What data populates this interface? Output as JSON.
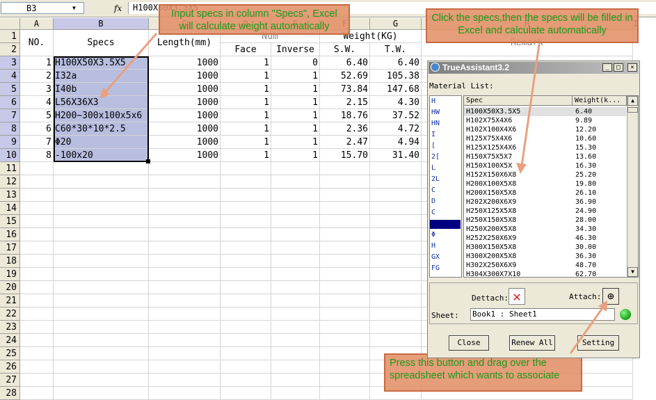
{
  "formula": {
    "name_box": "B3",
    "fx": "fx",
    "value": "H100X50X3.5X5"
  },
  "columns": [
    "A",
    "B",
    "C",
    "D",
    "E",
    "F",
    "G",
    "H",
    "I"
  ],
  "rows": [
    "1",
    "2",
    "3",
    "4",
    "5",
    "6",
    "7",
    "8",
    "9",
    "10",
    "11",
    "12",
    "13",
    "14",
    "15",
    "16",
    "17",
    "18",
    "19",
    "20",
    "21",
    "22",
    "23",
    "24",
    "25",
    "26",
    "27",
    "28"
  ],
  "headers": {
    "no": "NO.",
    "specs": "Specs",
    "length": "Length(mm)",
    "num": "Num",
    "face": "Face",
    "inverse": "Inverse",
    "weight": "Weight(KG)",
    "sw": "S.W.",
    "tw": "T.W.",
    "remark": "Remark"
  },
  "table": [
    {
      "no": "1",
      "spec": "H100X50X3.5X5",
      "length": "1000",
      "face": "1",
      "inverse": "0",
      "sw": "6.40",
      "tw": "6.40"
    },
    {
      "no": "2",
      "spec": "I32a",
      "length": "1000",
      "face": "1",
      "inverse": "1",
      "sw": "52.69",
      "tw": "105.38"
    },
    {
      "no": "3",
      "spec": "I40b",
      "length": "1000",
      "face": "1",
      "inverse": "1",
      "sw": "73.84",
      "tw": "147.68"
    },
    {
      "no": "4",
      "spec": "L56X36X3",
      "length": "1000",
      "face": "1",
      "inverse": "1",
      "sw": "2.15",
      "tw": "4.30"
    },
    {
      "no": "5",
      "spec": "H200~300x100x5x6",
      "length": "1000",
      "face": "1",
      "inverse": "1",
      "sw": "18.76",
      "tw": "37.52"
    },
    {
      "no": "6",
      "spec": "C60*30*10*2.5",
      "length": "1000",
      "face": "1",
      "inverse": "1",
      "sw": "2.36",
      "tw": "4.72"
    },
    {
      "no": "7",
      "spec": "Φ20",
      "length": "1000",
      "face": "1",
      "inverse": "1",
      "sw": "2.47",
      "tw": "4.94"
    },
    {
      "no": "8",
      "spec": "-100x20",
      "length": "1000",
      "face": "1",
      "inverse": "1",
      "sw": "15.70",
      "tw": "31.40"
    }
  ],
  "callouts": {
    "input": "Input specs in column \"Specs\", Excel will calculate weight automatically",
    "click": "Click the specs,then the specs will be filled in Excel and calculate automatically",
    "press": "Press this button and drag over the spreadsheet which wants to associate"
  },
  "panel": {
    "title": "TrueAssistant3.2",
    "material_label": "Material List:",
    "spec_header": "Spec",
    "weight_header": "Weight(k...",
    "categories": [
      "H",
      "HW",
      "HN",
      "I",
      "[",
      "2[",
      "L",
      "2L",
      "C",
      "D",
      "C",
      "",
      "Φ",
      "H",
      "GX",
      "FG"
    ],
    "specs": [
      {
        "spec": "H100X50X3.5X5",
        "weight": "6.40"
      },
      {
        "spec": "H102X75X4X6",
        "weight": "9.89"
      },
      {
        "spec": "H102X100X4X6",
        "weight": "12.20"
      },
      {
        "spec": "H125X75X4X6",
        "weight": "10.60"
      },
      {
        "spec": "H125X125X4X6",
        "weight": "15.30"
      },
      {
        "spec": "H150X75X5X7",
        "weight": "13.60"
      },
      {
        "spec": "H150X100X5X",
        "weight": "16.30"
      },
      {
        "spec": "H152X150X6X8",
        "weight": "25.20"
      },
      {
        "spec": "H200X100X5X8",
        "weight": "19.80"
      },
      {
        "spec": "H200X150X5X8",
        "weight": "26.10"
      },
      {
        "spec": "H202X200X6X9",
        "weight": "36.90"
      },
      {
        "spec": "H250X125X5X8",
        "weight": "24.90"
      },
      {
        "spec": "H250X150X5X8",
        "weight": "28.00"
      },
      {
        "spec": "H250X200X5X8",
        "weight": "34.30"
      },
      {
        "spec": "H252X250X6X9",
        "weight": "46.30"
      },
      {
        "spec": "H300X150X5X8",
        "weight": "30.00"
      },
      {
        "spec": "H300X200X5X8",
        "weight": "36.30"
      },
      {
        "spec": "H302X250X6X9",
        "weight": "48.70"
      },
      {
        "spec": "H304X300X7X10",
        "weight": "62.70"
      }
    ],
    "dettach_label": "Dettach:",
    "attach_label": "Attach:",
    "sheet_label": "Sheet:",
    "sheet_value": "Book1 : Sheet1",
    "close_label": "Close",
    "renew_label": "Renew All",
    "setting_label": "Setting"
  },
  "colors": {
    "selection": "#b8bee0",
    "callout_bg": "#e29068",
    "callout_text": "#1a9a1a",
    "dettach_red": "#e02020",
    "status_green": "#20b020"
  }
}
